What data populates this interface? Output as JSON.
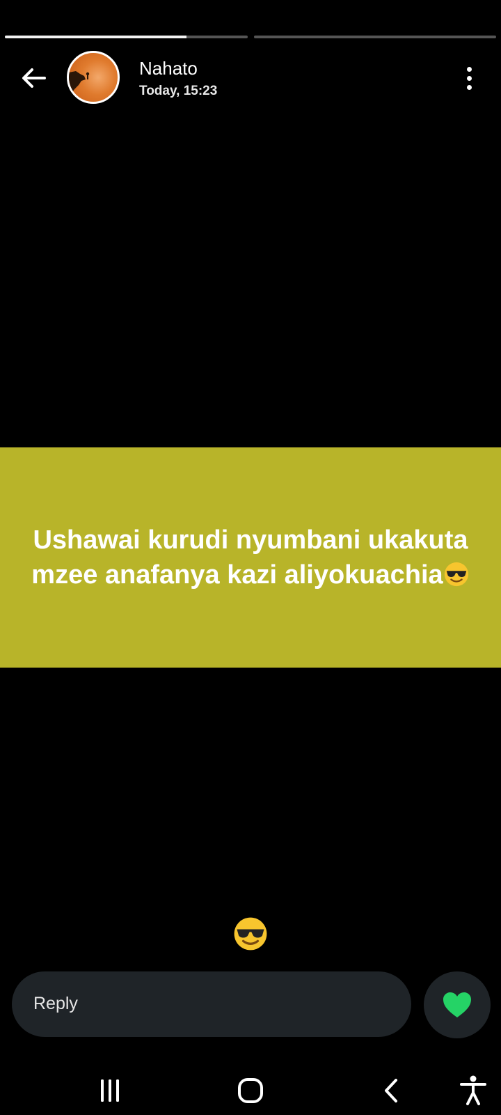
{
  "status": {
    "progress_segments": [
      {
        "fill_fraction": 0.75
      },
      {
        "fill_fraction": 0.0
      }
    ]
  },
  "header": {
    "contact_name": "Nahato",
    "timestamp": "Today, 15:23"
  },
  "story": {
    "background_color": "#b8b429",
    "text": "Ushawai kurudi nyumbani ukakuta mzee anafanya kazi aliyokuachia",
    "text_emoji": "smiling-face-with-sunglasses-icon"
  },
  "caption": {
    "emoji": "smiling-face-with-sunglasses-icon"
  },
  "reply": {
    "placeholder": "Reply",
    "like_color": "#25d366"
  },
  "navigation": {
    "icons": [
      "recent-apps-icon",
      "home-icon",
      "back-icon",
      "accessibility-icon"
    ]
  }
}
